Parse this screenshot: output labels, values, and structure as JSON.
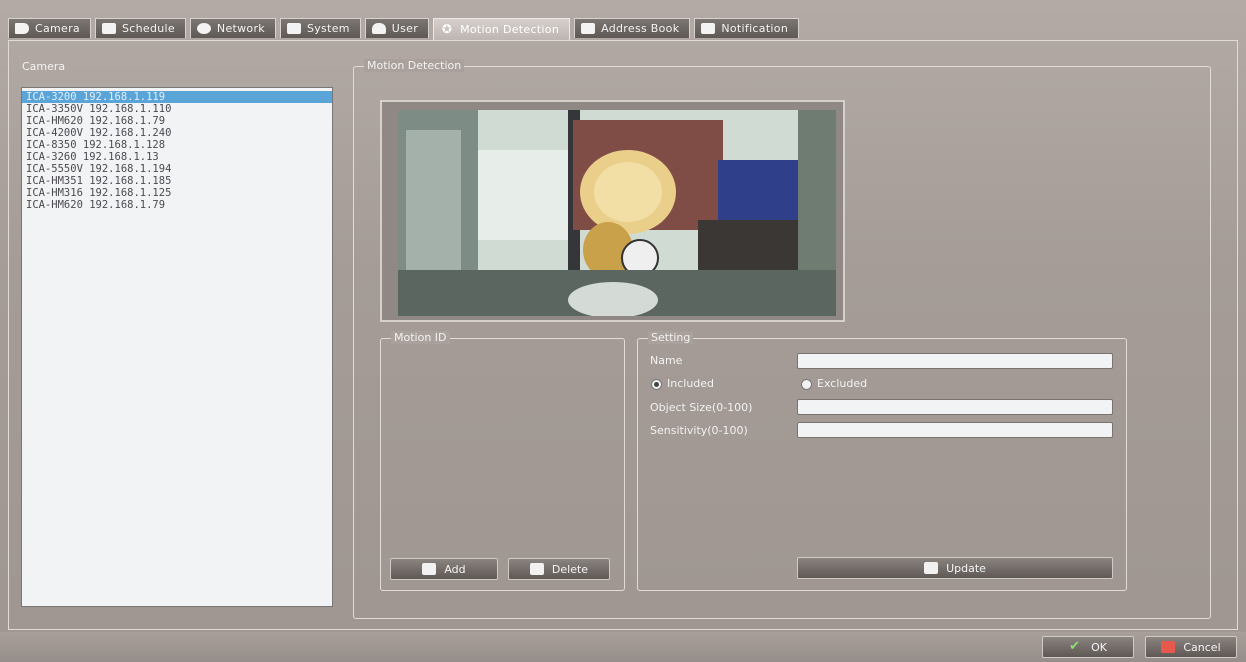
{
  "tabs": [
    {
      "label": "Camera",
      "icon": "camera-icon",
      "active": false
    },
    {
      "label": "Schedule",
      "icon": "schedule-icon",
      "active": false
    },
    {
      "label": "Network",
      "icon": "network-icon",
      "active": false
    },
    {
      "label": "System",
      "icon": "system-icon",
      "active": false
    },
    {
      "label": "User",
      "icon": "user-icon",
      "active": false
    },
    {
      "label": "Motion Detection",
      "icon": "motion-icon",
      "active": true
    },
    {
      "label": "Address Book",
      "icon": "address-book-icon",
      "active": false
    },
    {
      "label": "Notification",
      "icon": "notification-icon",
      "active": false
    }
  ],
  "camera_panel": {
    "label": "Camera",
    "cameras": [
      "ICA-3200 192.168.1.119",
      "ICA-3350V 192.168.1.110",
      "ICA-HM620 192.168.1.79",
      "ICA-4200V 192.168.1.240",
      "ICA-8350 192.168.1.128",
      "ICA-3260 192.168.1.13",
      "ICA-5550V 192.168.1.194",
      "ICA-HM351 192.168.1.185",
      "ICA-HM316 192.168.1.125",
      "ICA-HM620 192.168.1.79"
    ],
    "selected_index": 0
  },
  "motion_detection": {
    "title": "Motion Detection",
    "motion_id": {
      "title": "Motion ID",
      "add_label": "Add",
      "delete_label": "Delete"
    },
    "setting": {
      "title": "Setting",
      "name_label": "Name",
      "name_value": "",
      "included_label": "Included",
      "excluded_label": "Excluded",
      "selected_mode": "Included",
      "object_size_label": "Object Size(0-100)",
      "object_size_value": "",
      "sensitivity_label": "Sensitivity(0-100)",
      "sensitivity_value": "",
      "update_label": "Update"
    }
  },
  "footer": {
    "ok_label": "OK",
    "cancel_label": "Cancel"
  },
  "colors": {
    "background": "#a69c97",
    "selection": "#5aa4d8",
    "cancel_icon": "#e8584c",
    "ok_icon": "#8fe071"
  }
}
